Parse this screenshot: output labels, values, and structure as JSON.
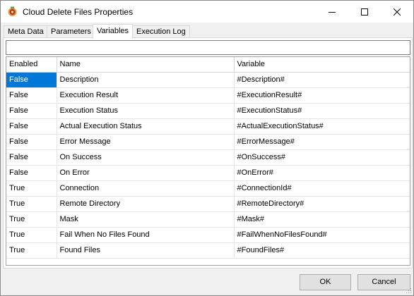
{
  "window": {
    "title": "Cloud Delete Files Properties",
    "icon": "app-gear-icon"
  },
  "tabs": [
    {
      "label": "Meta Data",
      "active": false
    },
    {
      "label": "Parameters",
      "active": false
    },
    {
      "label": "Variables",
      "active": true
    },
    {
      "label": "Execution Log",
      "active": false
    }
  ],
  "filter": {
    "value": "",
    "placeholder": ""
  },
  "grid": {
    "columns": [
      "Enabled",
      "Name",
      "Variable"
    ],
    "rows": [
      [
        "False",
        "Description",
        "#Description#"
      ],
      [
        "False",
        "Execution Result",
        "#ExecutionResult#"
      ],
      [
        "False",
        "Execution Status",
        "#ExecutionStatus#"
      ],
      [
        "False",
        "Actual Execution Status",
        "#ActualExecutionStatus#"
      ],
      [
        "False",
        "Error Message",
        "#ErrorMessage#"
      ],
      [
        "False",
        "On Success",
        "#OnSuccess#"
      ],
      [
        "False",
        "On Error",
        "#OnError#"
      ],
      [
        "True",
        "Connection",
        "#ConnectionId#"
      ],
      [
        "True",
        "Remote Directory",
        "#RemoteDirectory#"
      ],
      [
        "True",
        "Mask",
        "#Mask#"
      ],
      [
        "True",
        "Fail When No Files Found",
        "#FailWhenNoFilesFound#"
      ],
      [
        "True",
        "Found Files",
        "#FoundFiles#"
      ]
    ],
    "selected_cell": "0.0"
  },
  "buttons": {
    "ok": "OK",
    "cancel": "Cancel"
  },
  "colors": {
    "selection": "#0078d7",
    "button_face": "#e1e1e1"
  }
}
